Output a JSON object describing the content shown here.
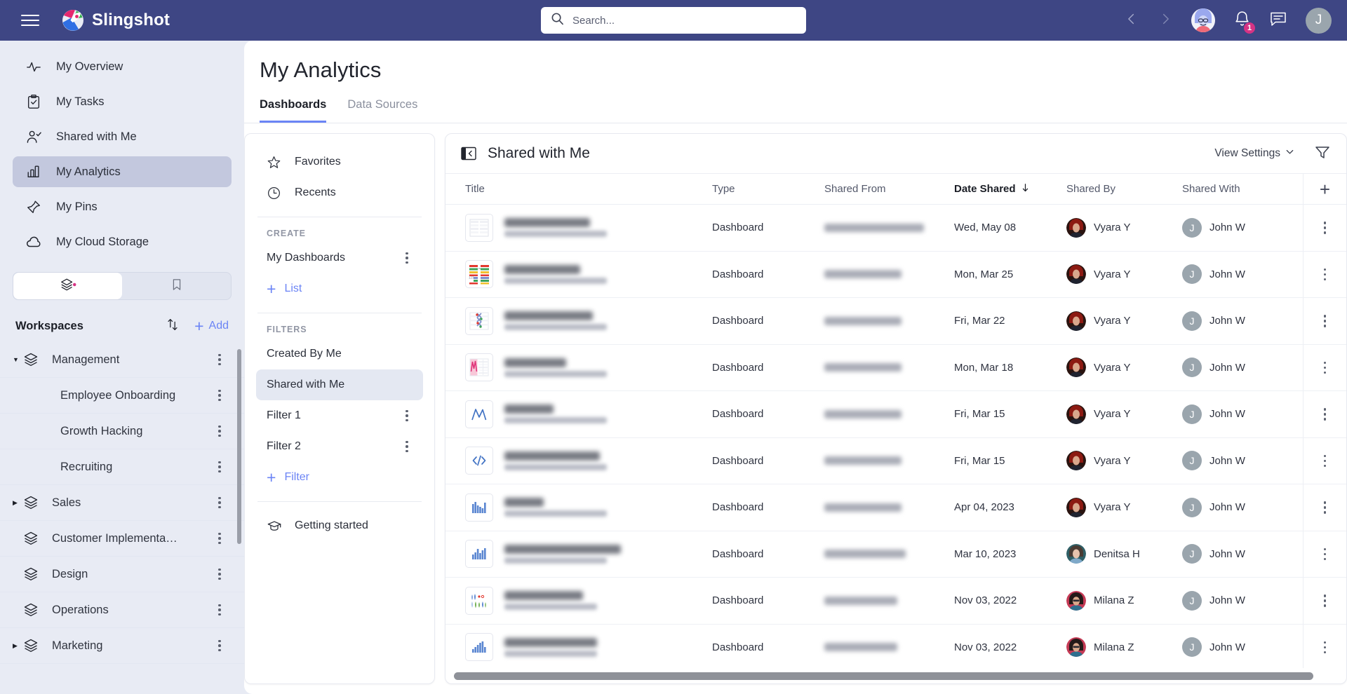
{
  "app": {
    "brand": "Slingshot"
  },
  "topbar": {
    "menu_icon": "hamburger-icon",
    "search": {
      "placeholder": "Search...",
      "value": "",
      "icon": "search-icon"
    },
    "back_icon": "chevron-left-icon",
    "forward_icon": "chevron-right-icon",
    "assistant_icon": "assistant-avatar",
    "notifications": {
      "icon": "bell-icon",
      "count": "1"
    },
    "chat_icon": "chat-icon",
    "user_initial": "J"
  },
  "sidebar": {
    "nav": [
      {
        "label": "My Overview",
        "icon": "pulse-icon",
        "active": false
      },
      {
        "label": "My Tasks",
        "icon": "clipboard-check-icon",
        "active": false
      },
      {
        "label": "Shared with Me",
        "icon": "user-check-icon",
        "active": false
      },
      {
        "label": "My Analytics",
        "icon": "bar-chart-icon",
        "active": true
      },
      {
        "label": "My Pins",
        "icon": "pin-icon",
        "active": false
      },
      {
        "label": "My Cloud Storage",
        "icon": "cloud-icon",
        "active": false
      }
    ],
    "toggle": {
      "layers_icon": "layers-icon",
      "bookmark_icon": "bookmark-icon"
    },
    "workspaces": {
      "title": "Workspaces",
      "sort_icon": "sort-arrows-icon",
      "add_label": "Add",
      "items": [
        {
          "label": "Management",
          "level": 0,
          "expanded": true
        },
        {
          "label": "Employee Onboarding",
          "level": 1
        },
        {
          "label": "Growth Hacking",
          "level": 1
        },
        {
          "label": "Recruiting",
          "level": 1
        },
        {
          "label": "Sales",
          "level": 0,
          "expanded": false
        },
        {
          "label": "Customer Implementa…",
          "level": 0
        },
        {
          "label": "Design",
          "level": 0
        },
        {
          "label": "Operations",
          "level": 0
        },
        {
          "label": "Marketing",
          "level": 0,
          "expanded": false
        }
      ]
    }
  },
  "main": {
    "title": "My Analytics",
    "tabs": [
      {
        "label": "Dashboards",
        "active": true
      },
      {
        "label": "Data Sources",
        "active": false
      }
    ]
  },
  "filters_panel": {
    "quick": [
      {
        "label": "Favorites",
        "icon": "star-icon"
      },
      {
        "label": "Recents",
        "icon": "clock-icon"
      }
    ],
    "create_label": "CREATE",
    "create_items": [
      {
        "label": "My Dashboards"
      }
    ],
    "create_add": "List",
    "filters_label": "FILTERS",
    "filter_items": [
      {
        "label": "Created By Me",
        "active": false,
        "kebab": false
      },
      {
        "label": "Shared with Me",
        "active": true,
        "kebab": false
      },
      {
        "label": "Filter 1",
        "active": false,
        "kebab": true
      },
      {
        "label": "Filter 2",
        "active": false,
        "kebab": true
      }
    ],
    "filter_add": "Filter",
    "getting_started": {
      "label": "Getting started",
      "icon": "graduation-cap-icon"
    }
  },
  "table": {
    "header_title": "Shared with Me",
    "collapse_icon": "collapse-panel-icon",
    "view_settings": "View Settings",
    "chevron_icon": "chevron-down-icon",
    "funnel_icon": "funnel-icon",
    "add_column_icon": "plus-icon",
    "columns": [
      "Title",
      "Type",
      "Shared From",
      "Date Shared",
      "Shared By",
      "Shared With"
    ],
    "sorted_column": "Date Shared",
    "sort_direction": "desc",
    "rows": [
      {
        "thumb": "table-thumb",
        "type": "Dashboard",
        "date": "Wed, May 08",
        "shared_by": "Vyara Y",
        "shared_with": "John W",
        "with_initial": "J"
      },
      {
        "thumb": "gauge-thumb",
        "type": "Dashboard",
        "date": "Mon, Mar 25",
        "shared_by": "Vyara Y",
        "shared_with": "John W",
        "with_initial": "J"
      },
      {
        "thumb": "scatter-thumb",
        "type": "Dashboard",
        "date": "Fri, Mar 22",
        "shared_by": "Vyara Y",
        "shared_with": "John W",
        "with_initial": "J"
      },
      {
        "thumb": "pink-area-thumb",
        "type": "Dashboard",
        "date": "Mon, Mar 18",
        "shared_by": "Vyara Y",
        "shared_with": "John W",
        "with_initial": "J"
      },
      {
        "thumb": "line-thumb",
        "type": "Dashboard",
        "date": "Fri, Mar 15",
        "shared_by": "Vyara Y",
        "shared_with": "John W",
        "with_initial": "J"
      },
      {
        "thumb": "code-thumb",
        "type": "Dashboard",
        "date": "Fri, Mar 15",
        "shared_by": "Vyara Y",
        "shared_with": "John W",
        "with_initial": "J"
      },
      {
        "thumb": "bar-thumb",
        "type": "Dashboard",
        "date": "Apr 04, 2023",
        "shared_by": "Vyara Y",
        "shared_with": "John W",
        "with_initial": "J"
      },
      {
        "thumb": "bar-thumb",
        "type": "Dashboard",
        "date": "Mar 10, 2023",
        "shared_by": "Denitsa H",
        "shared_with": "John W",
        "with_initial": "J"
      },
      {
        "thumb": "mixed-thumb",
        "type": "Dashboard",
        "date": "Nov 03, 2022",
        "shared_by": "Milana Z",
        "shared_with": "John W",
        "with_initial": "J"
      },
      {
        "thumb": "bar-asc-thumb",
        "type": "Dashboard",
        "date": "Nov 03, 2022",
        "shared_by": "Milana Z",
        "shared_with": "John W",
        "with_initial": "J"
      }
    ]
  },
  "colors": {
    "header_bg": "#3e4684",
    "app_bg": "#e8ebf4",
    "accent": "#6b84f5",
    "badge": "#d63384",
    "sidebar_active": "#c3c8de"
  }
}
